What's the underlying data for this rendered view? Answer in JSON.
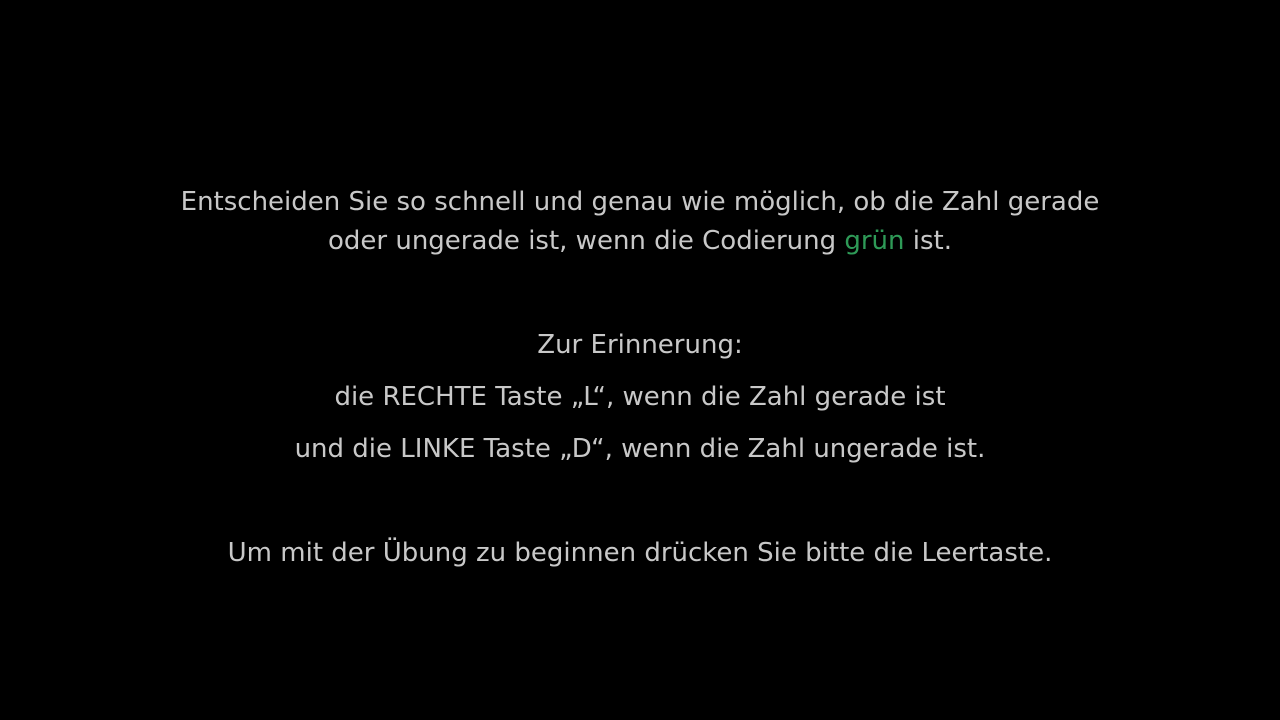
{
  "instruction": {
    "line1": "Entscheiden Sie so schnell und genau wie möglich, ob die Zahl gerade",
    "line2_before": "oder ungerade ist, wenn die Codierung ",
    "line2_highlight": "grün",
    "line2_after": " ist.",
    "highlight_color": "#2e9a57",
    "text_color": "#c8c8c8",
    "background_color": "#000000"
  },
  "reminder": {
    "heading": "Zur Erinnerung:",
    "right_key": "die RECHTE Taste „L“, wenn die Zahl gerade ist",
    "left_key": "und die LINKE Taste „D“, wenn die Zahl ungerade ist."
  },
  "start_prompt": "Um mit der Übung zu beginnen drücken Sie bitte die Leertaste."
}
